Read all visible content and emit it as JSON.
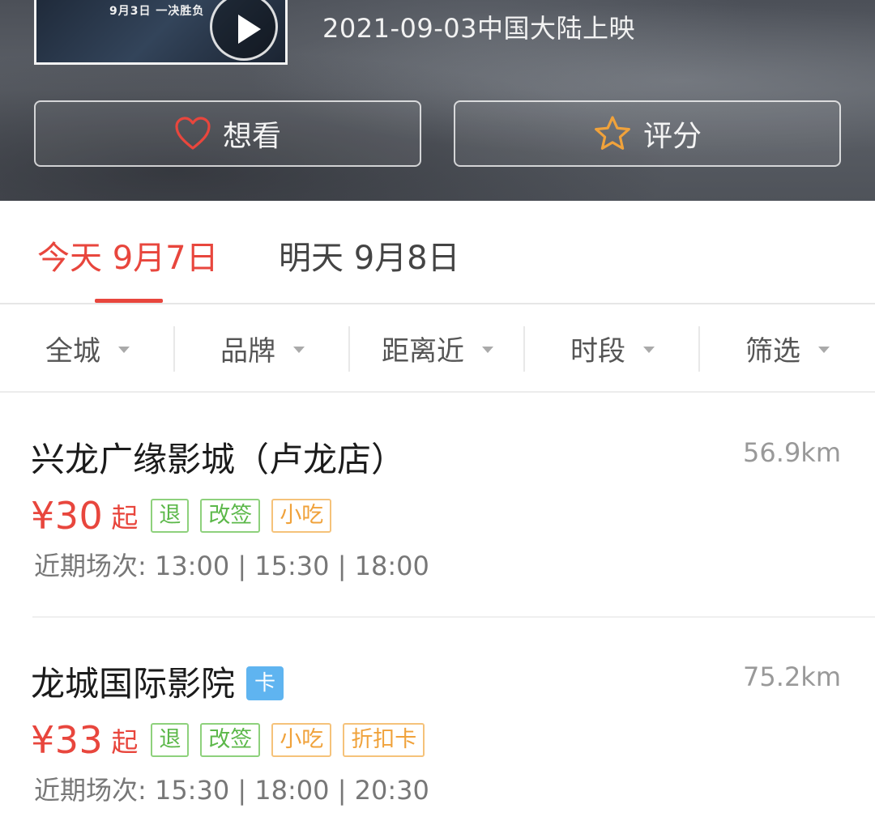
{
  "hero": {
    "poster_caption": "9月3日  一决胜负",
    "release_text": "2021-09-03中国大陆上映",
    "want_label": "想看",
    "rate_label": "评分"
  },
  "date_tabs": [
    {
      "label": "今天 9月7日",
      "active": true
    },
    {
      "label": "明天 9月8日",
      "active": false
    }
  ],
  "filters": [
    {
      "label": "全城"
    },
    {
      "label": "品牌"
    },
    {
      "label": "距离近"
    },
    {
      "label": "时段"
    },
    {
      "label": "筛选"
    }
  ],
  "cinemas": [
    {
      "name": "兴龙广缘影城（卢龙店）",
      "distance": "56.9km",
      "price": "¥30",
      "price_suffix": "起",
      "tags": [
        "退",
        "改签",
        "小吃"
      ],
      "sessions": "近期场次: 13:00 | 15:30 | 18:00"
    },
    {
      "name": "龙城国际影院",
      "badge": "卡",
      "distance": "75.2km",
      "price": "¥33",
      "price_suffix": "起",
      "tags": [
        "退",
        "改签",
        "小吃",
        "折扣卡"
      ],
      "sessions": "近期场次: 15:30 | 18:00 | 20:30"
    }
  ],
  "colors": {
    "accent": "#e8463d",
    "tag_green": "#5cb84a",
    "tag_orange": "#f0a23b",
    "badge_blue": "#5fb4f0",
    "star_orange": "#f0a23b"
  },
  "icons": {
    "want": "heart-outline-icon",
    "rate": "star-outline-icon",
    "play": "play-icon",
    "dropdown": "caret-down-icon"
  }
}
